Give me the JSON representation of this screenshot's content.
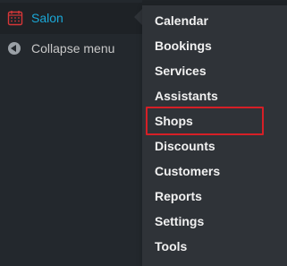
{
  "app": {
    "accent_color": "#1ba7d6",
    "sidebar_color": "#23282d",
    "submenu_color": "#2f3338",
    "highlight_color": "#d61f26"
  },
  "sidebar": {
    "active_item": {
      "label": "Salon",
      "icon": "calendar-icon"
    },
    "collapse_item": {
      "label": "Collapse menu",
      "icon": "collapse-menu-icon"
    }
  },
  "submenu": {
    "items": [
      {
        "label": "Calendar"
      },
      {
        "label": "Bookings"
      },
      {
        "label": "Services"
      },
      {
        "label": "Assistants"
      },
      {
        "label": "Shops"
      },
      {
        "label": "Discounts"
      },
      {
        "label": "Customers"
      },
      {
        "label": "Reports"
      },
      {
        "label": "Settings"
      },
      {
        "label": "Tools"
      }
    ],
    "highlighted_label": "Shops"
  }
}
